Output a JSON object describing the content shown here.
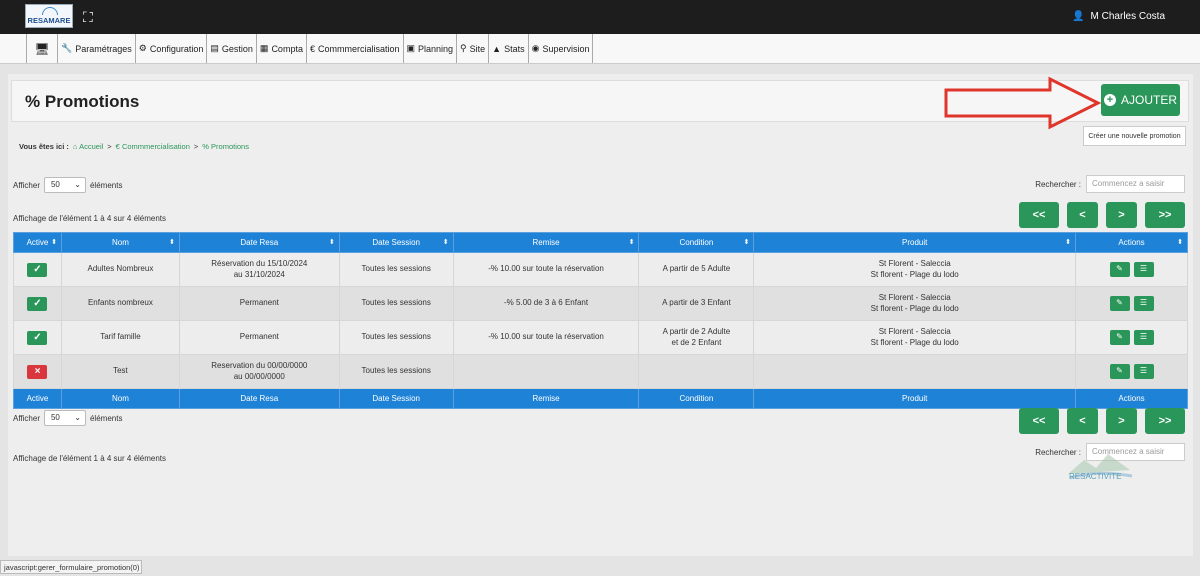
{
  "topbar": {
    "logo_text": "RESAMARE",
    "user_name": "M Charles Costa"
  },
  "menu": {
    "items": [
      {
        "label": "Paramétrages",
        "icon": "wrench-icon",
        "glyph": "🔧"
      },
      {
        "label": "Configuration",
        "icon": "gears-icon",
        "glyph": "⚙"
      },
      {
        "label": "Gestion",
        "icon": "list-icon",
        "glyph": "▤"
      },
      {
        "label": "Compta",
        "icon": "calculator-icon",
        "glyph": "▦"
      },
      {
        "label": "Commmercialisation",
        "icon": "euro-icon",
        "glyph": "€"
      },
      {
        "label": "Planning",
        "icon": "calendar-icon",
        "glyph": "▣"
      },
      {
        "label": "Site",
        "icon": "sitemap-icon",
        "glyph": "⚲"
      },
      {
        "label": "Stats",
        "icon": "chart-icon",
        "glyph": "▲"
      },
      {
        "label": "Supervision",
        "icon": "eye-icon",
        "glyph": "◉"
      }
    ]
  },
  "page": {
    "title": "Promotions",
    "title_icon": "%",
    "add_button": "AJOUTER",
    "add_tooltip": "Créer une nouvelle promotion"
  },
  "breadcrumb": {
    "prefix": "Vous êtes ici :",
    "items": [
      "Accueil",
      "Commmercialisation",
      "Promotions"
    ],
    "sep": ">"
  },
  "controls": {
    "show_label": "Afficher",
    "show_value": "50",
    "show_suffix": "éléments",
    "search_label": "Rechercher :",
    "search_placeholder": "Commencez a saisir",
    "info": "Affichage de l'élément 1 à 4 sur 4 éléments"
  },
  "pager": {
    "first": "<<",
    "prev": "<",
    "next": ">",
    "last": ">>"
  },
  "table": {
    "headers": [
      "Active",
      "Nom",
      "Date Resa",
      "Date Session",
      "Remise",
      "Condition",
      "Produit",
      "Actions"
    ],
    "rows": [
      {
        "active": true,
        "nom": "Adultes Nombreux",
        "date_resa": "Réservation du 15/10/2024\nau 31/10/2024",
        "date_session": "Toutes les sessions",
        "remise": "-% 10.00 sur toute la réservation",
        "condition": "A partir de 5 Adulte",
        "produit": "St Florent - Saleccia\nSt florent - Plage du lodo"
      },
      {
        "active": true,
        "nom": "Enfants nombreux",
        "date_resa": "Permanent",
        "date_session": "Toutes les sessions",
        "remise": "-% 5.00 de 3 à 6 Enfant",
        "condition": "A partir de 3 Enfant",
        "produit": "St Florent - Saleccia\nSt florent - Plage du lodo"
      },
      {
        "active": true,
        "nom": "Tarif famille",
        "date_resa": "Permanent",
        "date_session": "Toutes les sessions",
        "remise": "-% 10.00 sur toute la réservation",
        "condition": "A partir de 2 Adulte\net de 2 Enfant",
        "produit": "St Florent - Saleccia\nSt florent - Plage du lodo"
      },
      {
        "active": false,
        "nom": "Test",
        "date_resa": "Reservation du 00/00/0000\nau 00/00/0000",
        "date_session": "Toutes les sessions",
        "remise": "",
        "condition": "",
        "produit": ""
      }
    ]
  },
  "statusbar": {
    "text": "javascript:gerer_formulaire_promotion(0)"
  },
  "watermark": {
    "text": "RESACTIVITE"
  },
  "colors": {
    "primary": "#2a9659",
    "table_header": "#1e82d7",
    "danger": "#d9363e",
    "arrow": "#e0352b"
  }
}
